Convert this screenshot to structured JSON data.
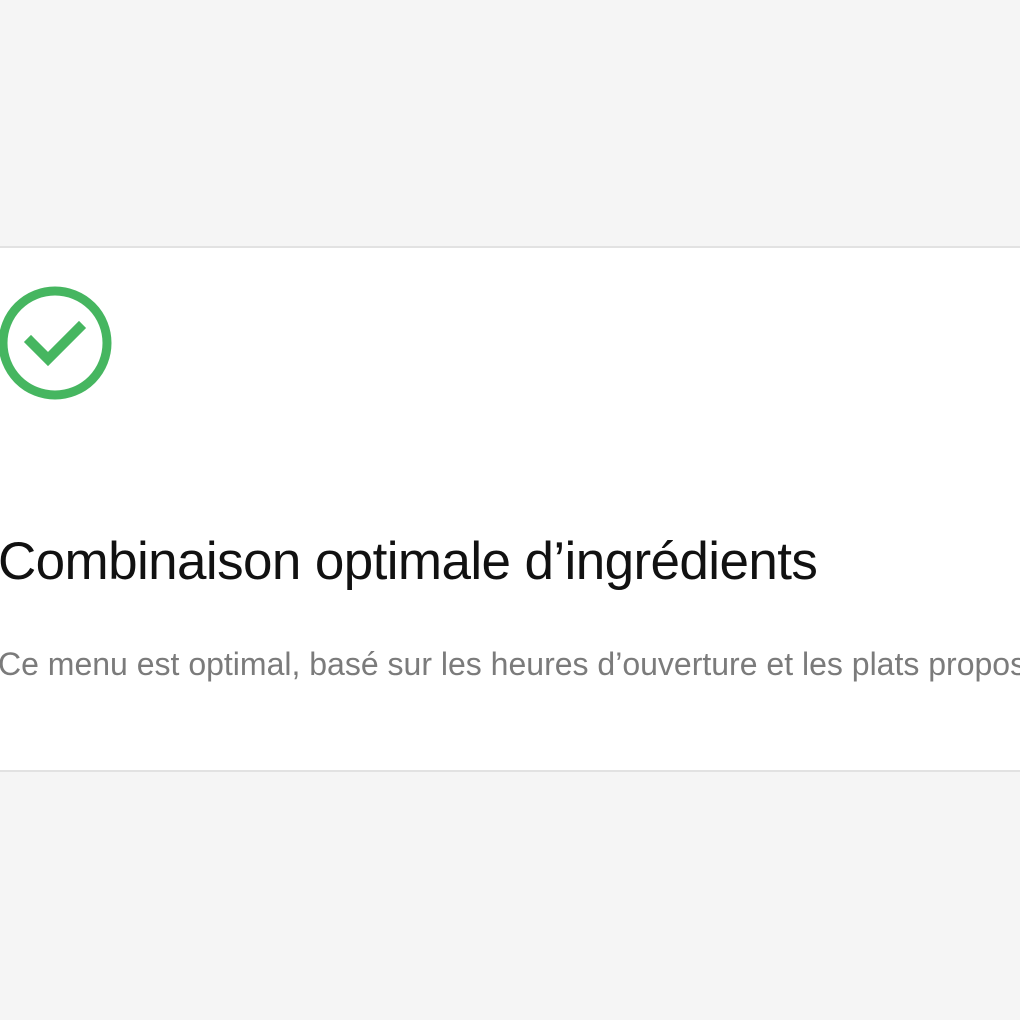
{
  "status": {
    "icon": "check-circle-icon",
    "color": "#46b660",
    "title": "Combinaison optimale d’ingrédients",
    "description": "Ce menu est optimal, basé sur les heures d’ouverture et les plats proposés."
  }
}
